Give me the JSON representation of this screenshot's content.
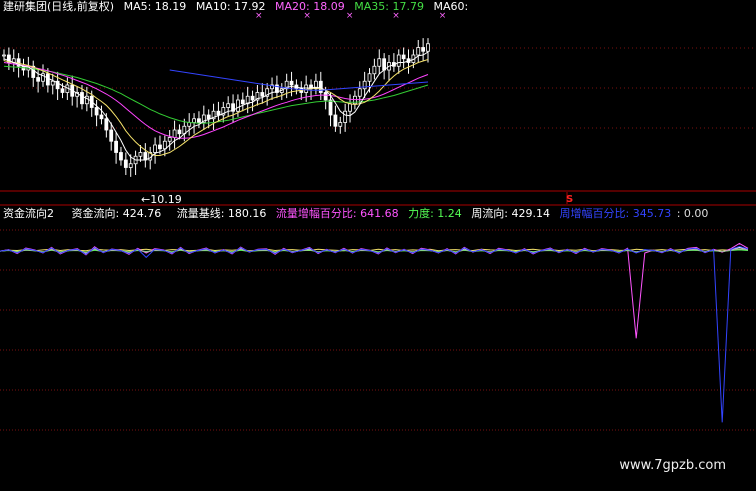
{
  "top_header": {
    "title": "建研集团(日线,前复权)",
    "items": [
      {
        "label": "MA5: 18.19",
        "color": "#ffffff"
      },
      {
        "label": "MA10: 17.92",
        "color": "#ffffff"
      },
      {
        "label": "MA20: 18.09",
        "color": "#ff66ff"
      },
      {
        "label": "MA35: 17.79",
        "color": "#44dd44"
      },
      {
        "label": "MA60:",
        "color": "#ffffff"
      }
    ],
    "marks": [
      "×",
      "×",
      "×",
      "×",
      "×"
    ]
  },
  "low_label": "←10.19",
  "s_marker": "S",
  "indicator_header": {
    "name": "资金流向2",
    "items": [
      {
        "label": "资金流向: 424.76",
        "color": "#ffffff"
      },
      {
        "label": "流量基线: 180.16",
        "color": "#ffffff"
      },
      {
        "label": "流量增幅百分比: 641.68",
        "color": "#ff55ff"
      },
      {
        "label": "力度: 1.24",
        "color": "#55ff55"
      },
      {
        "label": "周流向: 429.14",
        "color": "#ffffff"
      },
      {
        "label": "周增幅百分比: 345.73",
        "color": "#3344ff"
      },
      {
        "label": ": 0.00",
        "color": "#dddddd"
      }
    ]
  },
  "watermark": "www.7gpzb.com",
  "colors": {
    "up_candle": "#ffffff",
    "down_candle": "#ffffff",
    "ma5": "#ffffff",
    "ma10": "#f5e26b",
    "ma20": "#ff44ff",
    "ma35": "#33cc33",
    "ma60": "#3344ff",
    "grid": "#7a0f0f",
    "axis": "#aa0000"
  },
  "chart_data": {
    "type": "line",
    "title": "建研集团(日线,前复权)",
    "xlabel": "",
    "ylabel": "",
    "ylim": [
      10,
      14
    ],
    "price_series": {
      "close": [
        13.6,
        13.4,
        13.5,
        13.3,
        13.2,
        13.3,
        13.0,
        12.9,
        13.1,
        12.8,
        12.9,
        12.7,
        12.6,
        12.8,
        12.5,
        12.6,
        12.3,
        12.5,
        12.2,
        12.0,
        11.9,
        11.6,
        11.3,
        11.0,
        10.8,
        10.6,
        10.7,
        10.9,
        11.0,
        10.8,
        11.0,
        11.2,
        11.1,
        11.3,
        11.4,
        11.6,
        11.5,
        11.7,
        11.8,
        11.9,
        11.8,
        12.0,
        11.9,
        12.1,
        12.0,
        12.2,
        12.3,
        12.1,
        12.4,
        12.3,
        12.5,
        12.4,
        12.6,
        12.5,
        12.7,
        12.8,
        12.6,
        12.7,
        12.9,
        12.8,
        12.7,
        12.6,
        12.8,
        12.7,
        12.9,
        12.6,
        12.4,
        12.0,
        11.7,
        11.8,
        12.1,
        12.3,
        12.5,
        12.7,
        12.9,
        13.1,
        13.3,
        13.5,
        13.2,
        13.4,
        13.3,
        13.6,
        13.5,
        13.4,
        13.6,
        13.8,
        13.7,
        13.9
      ],
      "ma5": [
        13.5,
        13.45,
        13.4,
        13.35,
        13.3,
        13.28,
        13.2,
        13.1,
        13.05,
        12.98,
        12.92,
        12.86,
        12.78,
        12.72,
        12.66,
        12.58,
        12.5,
        12.44,
        12.36,
        12.24,
        12.12,
        11.96,
        11.76,
        11.54,
        11.32,
        11.06,
        10.88,
        10.8,
        10.8,
        10.8,
        10.86,
        10.98,
        11.02,
        11.08,
        11.2,
        11.32,
        11.38,
        11.5,
        11.6,
        11.7,
        11.74,
        11.84,
        11.88,
        11.94,
        11.98,
        12.04,
        12.1,
        12.12,
        12.2,
        12.26,
        12.32,
        12.34,
        12.44,
        12.46,
        12.54,
        12.6,
        12.62,
        12.66,
        12.74,
        12.76,
        12.74,
        12.72,
        12.72,
        12.72,
        12.74,
        12.72,
        12.66,
        12.52,
        12.32,
        12.1,
        12.0,
        11.98,
        12.08,
        12.28,
        12.5,
        12.7,
        12.9,
        13.1,
        13.2,
        13.3,
        13.34,
        13.4,
        13.4,
        13.44,
        13.48,
        13.58,
        13.6,
        13.68
      ],
      "ma10": [
        13.45,
        13.42,
        13.4,
        13.38,
        13.35,
        13.32,
        13.28,
        13.22,
        13.18,
        13.12,
        13.06,
        13.0,
        12.94,
        12.88,
        12.82,
        12.76,
        12.7,
        12.62,
        12.55,
        12.45,
        12.36,
        12.26,
        12.12,
        11.96,
        11.78,
        11.58,
        11.42,
        11.28,
        11.16,
        11.06,
        10.98,
        10.92,
        10.92,
        10.96,
        11.0,
        11.08,
        11.16,
        11.26,
        11.36,
        11.46,
        11.54,
        11.62,
        11.7,
        11.78,
        11.84,
        11.9,
        11.96,
        12.0,
        12.06,
        12.12,
        12.18,
        12.22,
        12.28,
        12.32,
        12.38,
        12.44,
        12.48,
        12.52,
        12.58,
        12.62,
        12.64,
        12.66,
        12.68,
        12.7,
        12.72,
        12.7,
        12.66,
        12.6,
        12.52,
        12.42,
        12.34,
        12.3,
        12.28,
        12.3,
        12.34,
        12.42,
        12.52,
        12.64,
        12.78,
        12.92,
        13.04,
        13.14,
        13.22,
        13.28,
        13.34,
        13.4,
        13.44,
        13.48
      ],
      "ma20": [
        13.4,
        13.38,
        13.36,
        13.34,
        13.32,
        13.3,
        13.27,
        13.24,
        13.21,
        13.18,
        13.14,
        13.1,
        13.06,
        13.02,
        12.97,
        12.92,
        12.87,
        12.82,
        12.76,
        12.7,
        12.63,
        12.56,
        12.48,
        12.39,
        12.29,
        12.18,
        12.07,
        11.96,
        11.85,
        11.75,
        11.66,
        11.58,
        11.52,
        11.47,
        11.43,
        11.4,
        11.38,
        11.38,
        11.39,
        11.41,
        11.44,
        11.48,
        11.53,
        11.58,
        11.63,
        11.68,
        11.74,
        11.8,
        11.86,
        11.91,
        11.96,
        12.01,
        12.06,
        12.11,
        12.16,
        12.21,
        12.26,
        12.3,
        12.34,
        12.38,
        12.42,
        12.45,
        12.48,
        12.5,
        12.52,
        12.53,
        12.53,
        12.52,
        12.5,
        12.47,
        12.44,
        12.42,
        12.41,
        12.41,
        12.42,
        12.44,
        12.47,
        12.51,
        12.56,
        12.62,
        12.68,
        12.74,
        12.8,
        12.86,
        12.92,
        12.98,
        13.03,
        13.08
      ],
      "ma35": [
        13.3,
        13.29,
        13.28,
        13.27,
        13.26,
        13.25,
        13.23,
        13.21,
        13.19,
        13.17,
        13.15,
        13.12,
        13.09,
        13.06,
        13.03,
        13.0,
        12.96,
        12.92,
        12.88,
        12.84,
        12.79,
        12.74,
        12.69,
        12.63,
        12.57,
        12.5,
        12.43,
        12.36,
        12.29,
        12.22,
        12.15,
        12.09,
        12.03,
        11.98,
        11.93,
        11.89,
        11.85,
        11.82,
        11.8,
        11.79,
        11.78,
        11.78,
        11.79,
        11.8,
        11.82,
        11.84,
        11.86,
        11.89,
        11.92,
        11.95,
        11.98,
        12.01,
        12.04,
        12.07,
        12.1,
        12.13,
        12.16,
        12.19,
        12.22,
        12.25,
        12.27,
        12.29,
        12.31,
        12.33,
        12.35,
        12.36,
        12.37,
        12.37,
        12.36,
        12.35,
        12.34,
        12.34,
        12.34,
        12.35,
        12.36,
        12.38,
        12.4,
        12.43,
        12.46,
        12.49,
        12.52,
        12.56,
        12.6,
        12.64,
        12.68,
        12.72,
        12.76,
        12.8
      ],
      "ma60_start_index": 34,
      "ma60": [
        13.2,
        13.18,
        13.16,
        13.14,
        13.12,
        13.1,
        13.08,
        13.06,
        13.04,
        13.02,
        13.0,
        12.98,
        12.96,
        12.94,
        12.92,
        12.9,
        12.88,
        12.86,
        12.84,
        12.82,
        12.8,
        12.78,
        12.76,
        12.74,
        12.72,
        12.7,
        12.69,
        12.68,
        12.67,
        12.66,
        12.66,
        12.66,
        12.67,
        12.68,
        12.69,
        12.7,
        12.71,
        12.72,
        12.73,
        12.74,
        12.75,
        12.76,
        12.77,
        12.78,
        12.79,
        12.8,
        12.81,
        12.82,
        12.83,
        12.84,
        12.85,
        12.86,
        12.87,
        12.88
      ]
    },
    "indicator": {
      "ylim": [
        -60,
        10
      ],
      "series": [
        {
          "name": "资金流向",
          "color": "#ffffff",
          "values": [
            0,
            0.4,
            -0.5,
            0.6,
            0.3,
            -0.4,
            0.8,
            -0.6,
            0.2,
            0.5,
            -0.8,
            0.9,
            -0.3,
            0.4,
            0.2,
            -0.7,
            0.6,
            -0.4,
            0.5,
            0.3,
            -0.6,
            0.8,
            -0.5,
            0.2,
            0.7,
            -0.4,
            0.3,
            -0.6,
            0.9,
            -0.2,
            0.4,
            0.5,
            -0.7,
            0.6,
            -0.3,
            0.2,
            0.8,
            -0.5,
            0.4,
            -0.3,
            0.6,
            -0.4,
            0.5,
            0.2,
            -0.6,
            0.7,
            -0.3,
            0.4,
            -0.5,
            0.6,
            0.3,
            -0.4,
            0.5,
            -0.6,
            0.8,
            -0.2,
            0.4,
            -0.5,
            0.6,
            0.3,
            -0.4,
            0.5,
            -0.6,
            0.2,
            0.7,
            -0.3,
            0.4,
            -0.5,
            0.6,
            -0.2,
            0.5,
            0.3,
            -0.4,
            0.6,
            -0.5,
            0.4,
            0.2,
            -0.3,
            0.5,
            -0.4,
            0.6,
            0.8,
            -0.3,
            0.4,
            -0.2,
            0.5,
            1.2,
            0.6
          ]
        },
        {
          "name": "流量基线",
          "color": "#f5e26b",
          "values": [
            0,
            0.3,
            0.2,
            0.5,
            0.1,
            0.4,
            0.6,
            0.2,
            0.5,
            0.3,
            0.1,
            0.6,
            0.4,
            0.3,
            0.5,
            0.2,
            0.4,
            0.6,
            0.3,
            0.2,
            0.5,
            0.4,
            0.1,
            0.3,
            0.6,
            0.2,
            0.4,
            0.3,
            0.5,
            0.1,
            0.3,
            0.6,
            0.2,
            0.4,
            0.5,
            0.3,
            0.2,
            0.6,
            0.4,
            0.3,
            0.1,
            0.5,
            0.4,
            0.2,
            0.6,
            0.3,
            0.5,
            0.2,
            0.4,
            0.3,
            0.6,
            0.1,
            0.4,
            0.5,
            0.3,
            0.2,
            0.6,
            0.4,
            0.3,
            0.5,
            0.2,
            0.4,
            0.6,
            0.3,
            0.5,
            0.2,
            0.4,
            0.3,
            0.6,
            0.1,
            0.4,
            0.5,
            0.3,
            0.2,
            0.6,
            0.4,
            0.3,
            0.5,
            0.2,
            0.4,
            0.6,
            0.3,
            0.5,
            0.2,
            0.4,
            0.3,
            0.6,
            0.4
          ]
        },
        {
          "name": "流量增幅百分比",
          "color": "#ff55ff",
          "values": [
            0,
            0.5,
            -0.8,
            1.0,
            0.4,
            -0.6,
            1.2,
            -0.9,
            0.3,
            0.8,
            -1.2,
            1.4,
            -0.5,
            0.7,
            0.3,
            -1.0,
            0.9,
            -0.6,
            0.8,
            0.4,
            -0.9,
            1.2,
            -0.8,
            0.3,
            1.0,
            -0.6,
            0.5,
            -0.9,
            1.3,
            -0.3,
            0.6,
            0.8,
            -1.0,
            0.9,
            -0.5,
            0.3,
            1.2,
            -0.8,
            0.6,
            -0.5,
            0.9,
            -0.6,
            0.8,
            0.3,
            -0.9,
            1.0,
            -0.5,
            0.6,
            -0.8,
            0.9,
            0.4,
            -0.6,
            0.8,
            -0.9,
            1.2,
            -0.3,
            0.6,
            -0.8,
            0.9,
            0.4,
            -0.6,
            0.8,
            -0.9,
            0.3,
            1.0,
            -0.5,
            0.6,
            -0.8,
            0.9,
            -0.3,
            0.8,
            0.4,
            -0.6,
            0.9,
            -28,
            -0.6,
            0.3,
            -0.5,
            0.8,
            -0.6,
            0.9,
            1.2,
            -0.5,
            0.6,
            -0.3,
            0.8,
            2.5,
            0.9
          ]
        },
        {
          "name": "力度",
          "color": "#55ff55",
          "values": [
            0,
            0.2,
            -0.1,
            0.3,
            0.1,
            -0.2,
            0.3,
            -0.2,
            0.1,
            0.2,
            -0.3,
            0.3,
            -0.1,
            0.2,
            0.1,
            -0.2,
            0.2,
            -0.1,
            0.2,
            0.1,
            -0.2,
            0.3,
            -0.2,
            0.1,
            0.2,
            -0.1,
            0.1,
            -0.2,
            0.3,
            -0.1,
            0.1,
            0.2,
            -0.2,
            0.2,
            -0.1,
            0.1,
            0.3,
            -0.2,
            0.1,
            -0.1,
            0.2,
            -0.1,
            0.2,
            0.1,
            -0.2,
            0.2,
            -0.1,
            0.1,
            -0.2,
            0.2,
            0.1,
            -0.1,
            0.2,
            -0.2,
            0.3,
            -0.1,
            0.1,
            -0.2,
            0.2,
            0.1,
            -0.1,
            0.2,
            -0.2,
            0.1,
            0.2,
            -0.1,
            0.1,
            -0.2,
            0.2,
            -0.1,
            0.2,
            0.1,
            -0.1,
            0.2,
            -0.2,
            0.1,
            0.1,
            -0.1,
            0.2,
            -0.1,
            0.2,
            0.3,
            -0.1,
            0.1,
            -0.1,
            0.2,
            0.4,
            0.2
          ]
        },
        {
          "name": "周流向",
          "color": "#aaaaaa",
          "values": [
            0,
            0.3,
            -0.3,
            0.4,
            0.2,
            -0.3,
            0.5,
            -0.4,
            0.2,
            0.3,
            -0.5,
            0.6,
            -0.2,
            0.3,
            0.1,
            -0.4,
            0.4,
            -0.3,
            0.3,
            0.2,
            -0.4,
            0.5,
            -0.3,
            0.1,
            0.4,
            -0.3,
            0.2,
            -0.4,
            0.6,
            -0.1,
            0.3,
            0.3,
            -0.4,
            0.4,
            -0.2,
            0.1,
            0.5,
            -0.3,
            0.3,
            -0.2,
            0.4,
            -0.3,
            0.3,
            0.1,
            -0.4,
            0.4,
            -0.2,
            0.3,
            -0.3,
            0.4,
            0.2,
            -0.3,
            0.3,
            -0.4,
            0.5,
            -0.1,
            0.3,
            -0.3,
            0.4,
            0.2,
            -0.3,
            0.3,
            -0.4,
            0.1,
            0.4,
            -0.2,
            0.3,
            -0.3,
            0.4,
            -0.1,
            0.3,
            0.2,
            -0.3,
            0.4,
            -0.3,
            0.3,
            0.1,
            -0.2,
            0.3,
            -0.3,
            0.4,
            0.5,
            -0.2,
            0.3,
            -0.1,
            0.3,
            0.8,
            0.4
          ]
        },
        {
          "name": "周增幅百分比",
          "color": "#3344ff",
          "values": [
            0,
            0.4,
            -0.6,
            0.8,
            0.3,
            -0.5,
            1.0,
            -0.7,
            0.3,
            0.6,
            -1.0,
            1.1,
            -0.4,
            0.6,
            0.2,
            -0.8,
            0.7,
            -2.0,
            0.6,
            0.3,
            -0.7,
            1.0,
            -0.6,
            0.2,
            0.8,
            -0.5,
            0.4,
            -0.7,
            1.1,
            -0.2,
            0.5,
            0.6,
            -0.8,
            0.7,
            -0.4,
            0.2,
            1.0,
            -0.6,
            0.5,
            -0.4,
            0.7,
            -0.5,
            0.6,
            0.2,
            -0.7,
            0.8,
            -0.4,
            0.5,
            -0.6,
            0.7,
            0.3,
            -0.5,
            0.6,
            -0.7,
            1.0,
            -0.2,
            0.5,
            -0.6,
            0.7,
            0.3,
            -0.5,
            0.6,
            -0.7,
            0.2,
            0.8,
            -0.4,
            0.5,
            -0.6,
            0.7,
            -0.2,
            0.6,
            0.3,
            -0.5,
            0.7,
            -0.6,
            0.5,
            0.2,
            -0.4,
            0.6,
            -0.5,
            0.7,
            0.9,
            -0.4,
            0.5,
            -55,
            0.6,
            1.5,
            0.7
          ]
        }
      ]
    }
  }
}
